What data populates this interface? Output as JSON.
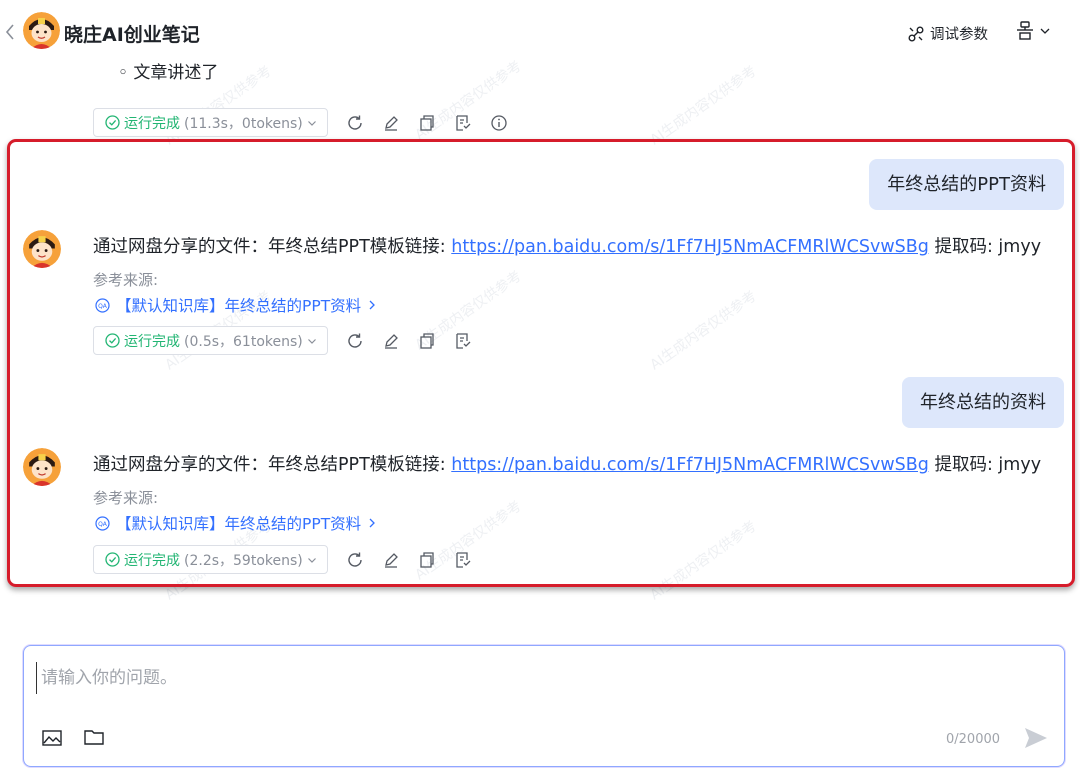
{
  "header": {
    "title": "晓庄AI创业笔记",
    "debug_label": "调试参数"
  },
  "partial_text": "◦ 文章讲述了",
  "top_status": {
    "done_label": "运行完成",
    "stats": "(11.3s，0tokens)"
  },
  "messages": [
    {
      "user_text": "年终总结的PPT资料",
      "answer_prefix": "通过网盘分享的文件：年终总结PPT模板链接: ",
      "answer_link": "https://pan.baidu.com/s/1Ff7HJ5NmACFMRlWCSvwSBg",
      "answer_suffix": " 提取码: jmyy",
      "ref_label": "参考来源:",
      "ref_item": "【默认知识库】年终总结的PPT资料",
      "status_done": "运行完成",
      "status_stats": "(0.5s，61tokens)"
    },
    {
      "user_text": "年终总结的资料",
      "answer_prefix": "通过网盘分享的文件：年终总结PPT模板链接: ",
      "answer_link": "https://pan.baidu.com/s/1Ff7HJ5NmACFMRlWCSvwSBg",
      "answer_suffix": " 提取码: jmyy",
      "ref_label": "参考来源:",
      "ref_item": "【默认知识库】年终总结的PPT资料",
      "status_done": "运行完成",
      "status_stats": "(2.2s，59tokens)"
    }
  ],
  "watermark": "AI生成内容仅供参考",
  "input": {
    "placeholder": "请输入你的问题。",
    "counter": "0/20000"
  },
  "colors": {
    "accent": "#3370ff",
    "success": "#22b573",
    "highlight_frame": "#d61c2b",
    "user_bubble": "#dde7fb"
  }
}
